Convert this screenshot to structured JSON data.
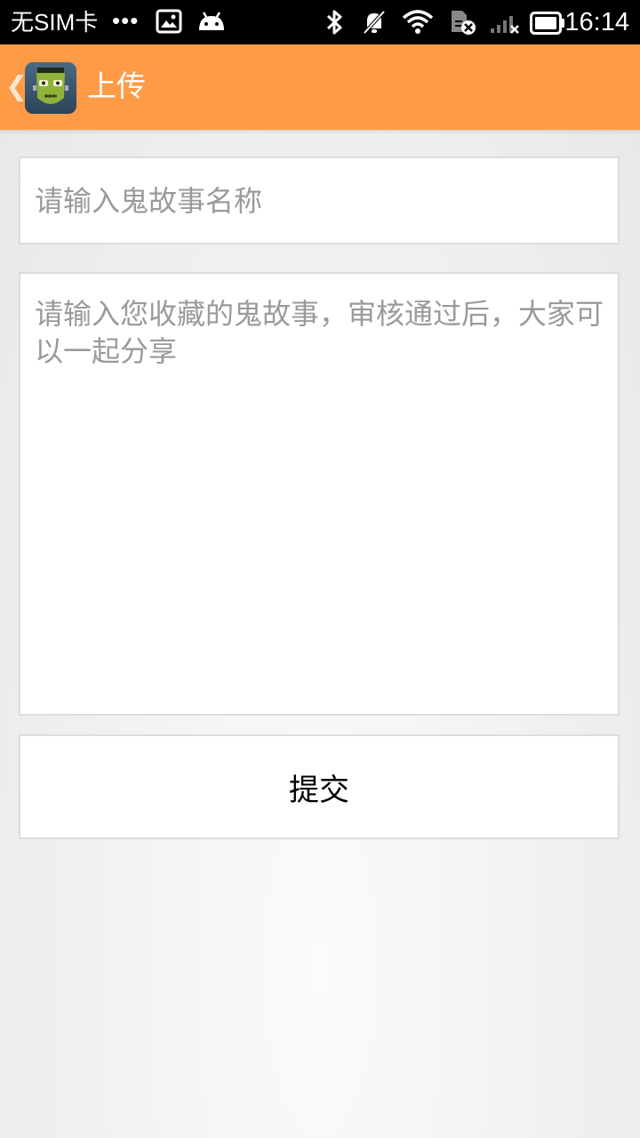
{
  "status_bar": {
    "carrier": "无SIM卡",
    "dots": "•••",
    "time": "16:14",
    "icons": [
      "image-notification-icon",
      "android-icon",
      "bluetooth-icon",
      "mute-icon",
      "wifi-icon",
      "no-sim-icon",
      "signal-icon",
      "battery-icon"
    ]
  },
  "action_bar": {
    "back_glyph": "❮",
    "app_icon": "zombie-app-icon",
    "title": "上传",
    "color": "#ff9a47"
  },
  "form": {
    "title_placeholder": "请输入鬼故事名称",
    "content_placeholder": "请输入您收藏的鬼故事，审核通过后，大家可以一起分享",
    "submit_label": "提交"
  }
}
